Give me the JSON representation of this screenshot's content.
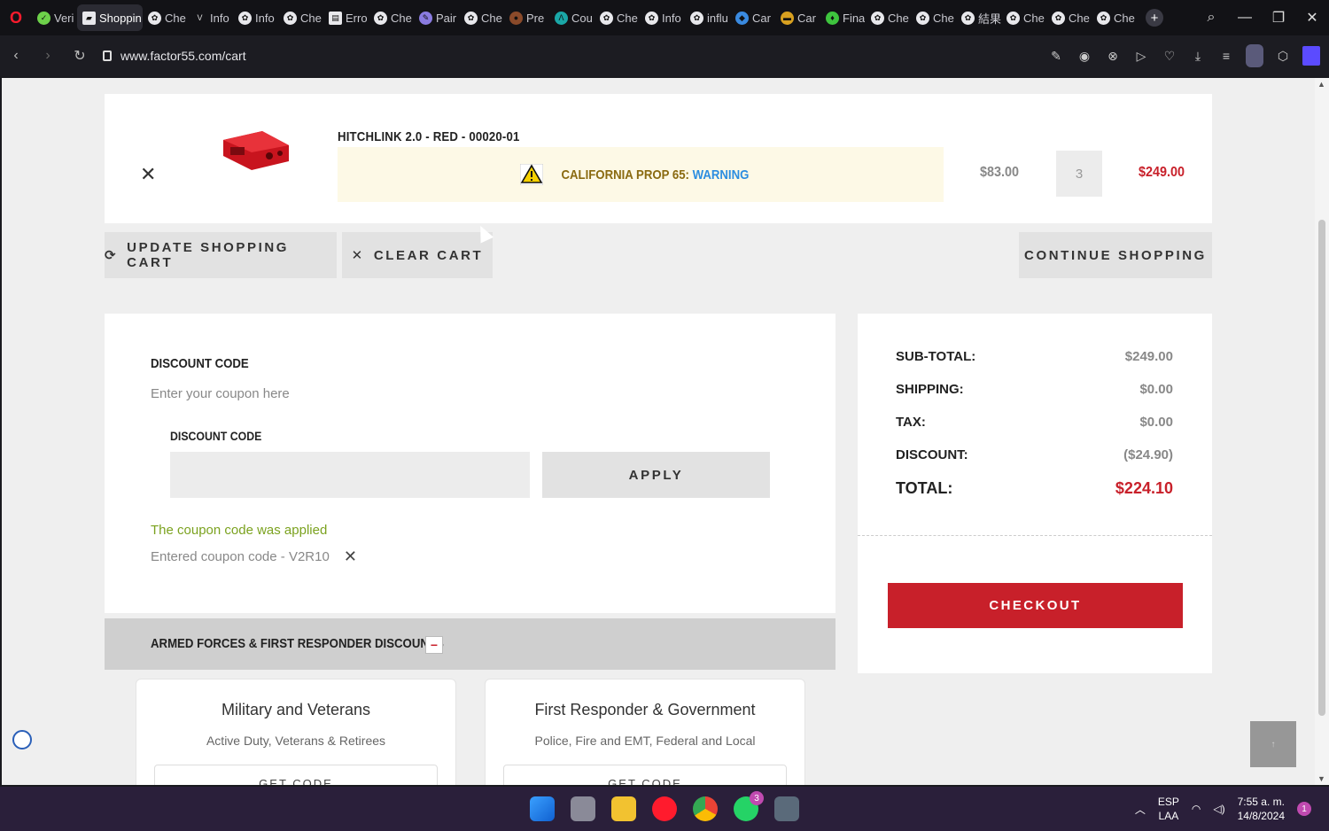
{
  "browser": {
    "tabs": [
      {
        "label": "Veri",
        "icon": "check-icon"
      },
      {
        "label": "Shoppin",
        "icon": "factor55-icon",
        "active": true
      },
      {
        "label": "Che",
        "icon": "openai-icon"
      },
      {
        "label": "Info",
        "icon": "v-icon"
      },
      {
        "label": "Info",
        "icon": "openai-icon"
      },
      {
        "label": "Che",
        "icon": "openai-icon"
      },
      {
        "label": "Erro",
        "icon": "doc-icon"
      },
      {
        "label": "Che",
        "icon": "openai-icon"
      },
      {
        "label": "Pair",
        "icon": "pen-icon"
      },
      {
        "label": "Che",
        "icon": "openai-icon"
      },
      {
        "label": "Pre",
        "icon": "bean-icon"
      },
      {
        "label": "Cou",
        "icon": "a-icon"
      },
      {
        "label": "Che",
        "icon": "openai-icon"
      },
      {
        "label": "Info",
        "icon": "openai-icon"
      },
      {
        "label": "influ",
        "icon": "openai-icon"
      },
      {
        "label": "Car",
        "icon": "diamond-icon"
      },
      {
        "label": "Car",
        "icon": "car-icon"
      },
      {
        "label": "Fina",
        "icon": "leaf-icon"
      },
      {
        "label": "Che",
        "icon": "openai-icon"
      },
      {
        "label": "Che",
        "icon": "openai-icon"
      },
      {
        "label": "結果",
        "icon": "openai-icon"
      },
      {
        "label": "Che",
        "icon": "openai-icon"
      },
      {
        "label": "Che",
        "icon": "openai-icon"
      },
      {
        "label": "Che",
        "icon": "openai-icon"
      }
    ],
    "url": "www.factor55.com/cart"
  },
  "cart": {
    "item": {
      "name": "HITCHLINK 2.0 - RED - 00020-01",
      "prop65_prefix": "CALIFORNIA PROP 65:",
      "prop65_link": "WARNING",
      "unit_price": "$83.00",
      "quantity": "3",
      "line_total": "$249.00"
    },
    "buttons": {
      "update": "UPDATE SHOPPING CART",
      "clear": "CLEAR CART",
      "continue": "CONTINUE SHOPPING"
    }
  },
  "discount": {
    "heading": "DISCOUNT CODE",
    "hint": "Enter your coupon here",
    "field_label": "DISCOUNT CODE",
    "input_value": "",
    "apply_label": "APPLY",
    "success_message": "The coupon code was applied",
    "entered_code": "Entered coupon code - V2R10"
  },
  "summary": {
    "subtotal_label": "SUB-TOTAL:",
    "subtotal": "$249.00",
    "shipping_label": "SHIPPING:",
    "shipping": "$0.00",
    "tax_label": "TAX:",
    "tax": "$0.00",
    "discount_label": "DISCOUNT:",
    "discount": "($24.90)",
    "total_label": "TOTAL:",
    "total": "$224.10",
    "checkout_label": "CHECKOUT"
  },
  "armed_forces": {
    "title": "ARMED FORCES & FIRST RESPONDER DISCOUNTS",
    "toggle": "−",
    "offers": [
      {
        "title": "Military and Veterans",
        "subtitle": "Active Duty, Veterans & Retirees",
        "button": "GET CODE"
      },
      {
        "title": "First Responder & Government",
        "subtitle": "Police, Fire and EMT, Federal and Local",
        "button": "GET CODE"
      }
    ]
  },
  "taskbar": {
    "lang_top": "ESP",
    "lang_bottom": "LAA",
    "time": "7:55 a. m.",
    "date": "14/8/2024",
    "whatsapp_badge": "3",
    "notification_count": "1"
  },
  "colors": {
    "accent_red": "#c8202a",
    "success_green": "#7ba21f",
    "link_blue": "#2b8de0"
  }
}
